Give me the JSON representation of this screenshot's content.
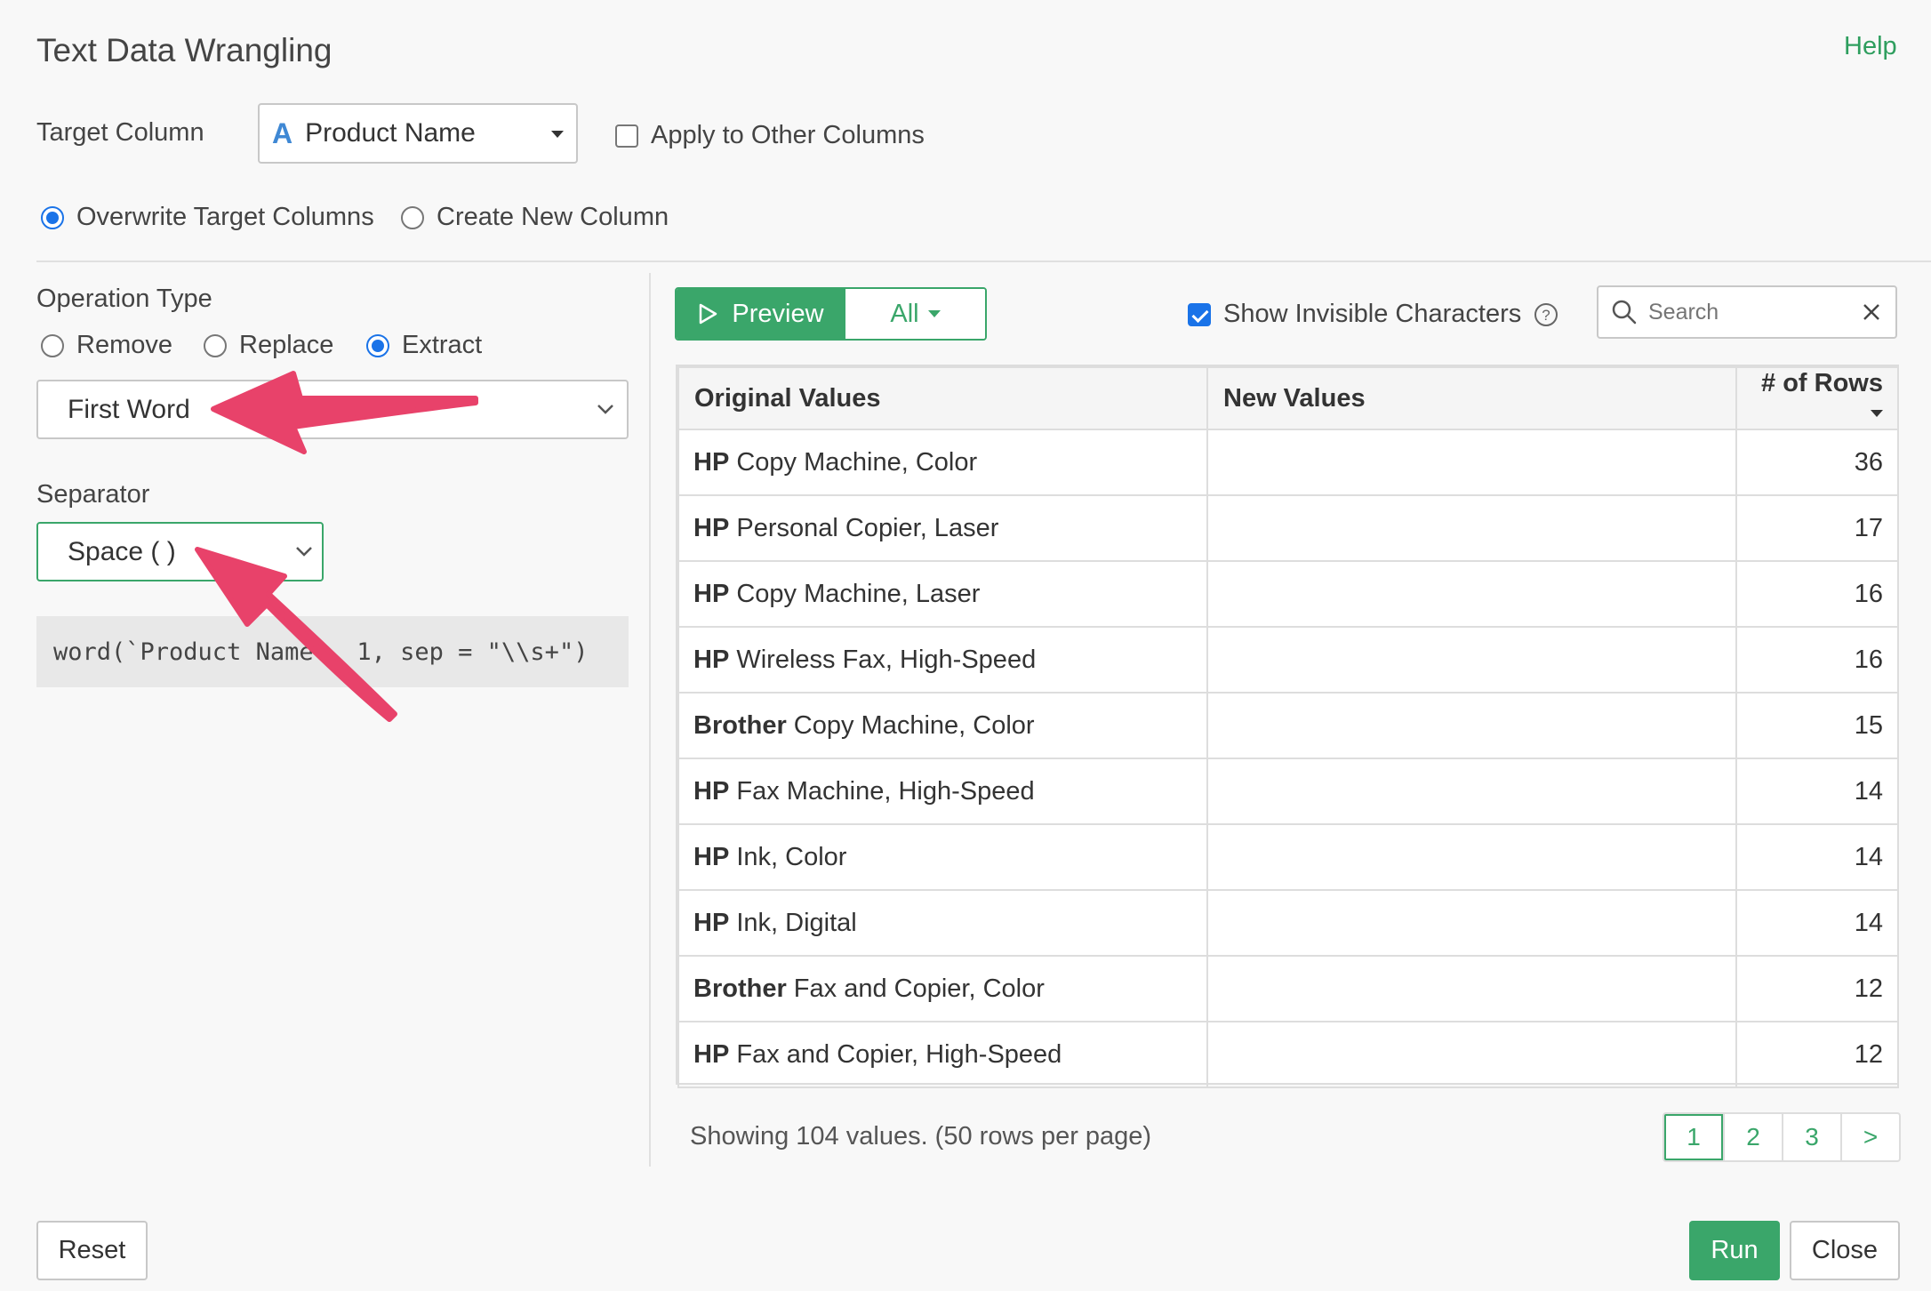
{
  "dialog": {
    "title": "Text Data Wrangling",
    "help_label": "Help"
  },
  "target": {
    "label": "Target Column",
    "column_value": "Product Name",
    "apply_other_label": "Apply to Other Columns",
    "apply_other_checked": false
  },
  "output_mode": {
    "overwrite_label": "Overwrite Target Columns",
    "create_new_label": "Create New Column",
    "selected": "overwrite"
  },
  "operation": {
    "label": "Operation Type",
    "remove_label": "Remove",
    "replace_label": "Replace",
    "extract_label": "Extract",
    "selected": "extract",
    "extract_value": "First Word"
  },
  "separator": {
    "label": "Separator",
    "value": "Space ( )"
  },
  "code_preview": "word(`Product Name`, 1, sep = \"\\\\s+\")",
  "preview": {
    "preview_label": "Preview",
    "all_label": "All",
    "show_invisible_label": "Show Invisible Characters",
    "show_invisible_checked": true,
    "search_placeholder": "Search"
  },
  "table": {
    "headers": {
      "original": "Original Values",
      "new": "New Values",
      "rows": "# of Rows"
    },
    "rows": [
      {
        "bold": "HP",
        "rest": " Copy Machine, Color",
        "new": "",
        "count": "36"
      },
      {
        "bold": "HP",
        "rest": " Personal Copier, Laser",
        "new": "",
        "count": "17"
      },
      {
        "bold": "HP",
        "rest": " Copy Machine, Laser",
        "new": "",
        "count": "16"
      },
      {
        "bold": "HP",
        "rest": " Wireless Fax, High-Speed",
        "new": "",
        "count": "16"
      },
      {
        "bold": "Brother",
        "rest": " Copy Machine, Color",
        "new": "",
        "count": "15"
      },
      {
        "bold": "HP",
        "rest": " Fax Machine, High-Speed",
        "new": "",
        "count": "14"
      },
      {
        "bold": "HP",
        "rest": " Ink, Color",
        "new": "",
        "count": "14"
      },
      {
        "bold": "HP",
        "rest": " Ink, Digital",
        "new": "",
        "count": "14"
      },
      {
        "bold": "Brother",
        "rest": " Fax and Copier, Color",
        "new": "",
        "count": "12"
      },
      {
        "bold": "HP",
        "rest": " Fax and Copier, High-Speed",
        "new": "",
        "count": "12"
      }
    ]
  },
  "footer": {
    "showing_text": "Showing 104 values. (50 rows per page)",
    "pages": [
      "1",
      "2",
      "3",
      ">"
    ],
    "current_page": "1",
    "reset_label": "Reset",
    "run_label": "Run",
    "close_label": "Close"
  },
  "colors": {
    "accent": "#3aa66a",
    "annotation_arrow": "#e8426a",
    "radio_blue": "#1a73e8"
  }
}
